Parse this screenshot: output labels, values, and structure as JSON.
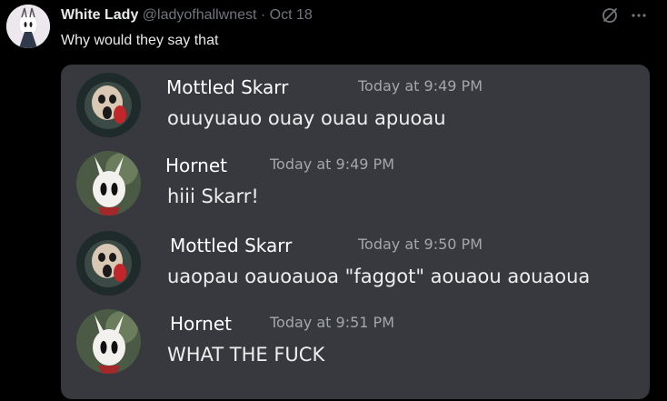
{
  "post": {
    "author_name": "White Lady",
    "author_handle": "@ladyofhallwnest",
    "separator": "·",
    "date": "Oct 18",
    "text": "Why would they say that",
    "icons": [
      "grok-icon",
      "more-icon"
    ]
  },
  "messages": [
    {
      "author": "Mottled Skarr",
      "time": "Today at 9:49 PM",
      "text": "ouuyuauo ouay ouau apuoau",
      "avatar": "skarr-avatar"
    },
    {
      "author": "Hornet",
      "time": "Today at 9:49 PM",
      "text": "hiii Skarr!",
      "avatar": "hornet-avatar"
    },
    {
      "author": "Mottled Skarr",
      "time": "Today at 9:50 PM",
      "text": "uaopau oauoauoa \"faggot\" aouaou aouaoua",
      "avatar": "skarr-avatar"
    },
    {
      "author": "Hornet",
      "time": "Today at 9:51 PM",
      "text": "WHAT THE FUCK",
      "avatar": "hornet-avatar"
    }
  ],
  "colors": {
    "background": "#000000",
    "card_background": "#37393e",
    "name": "#e7e9ea",
    "muted": "#71767b",
    "timestamp": "#a3a6aa"
  }
}
